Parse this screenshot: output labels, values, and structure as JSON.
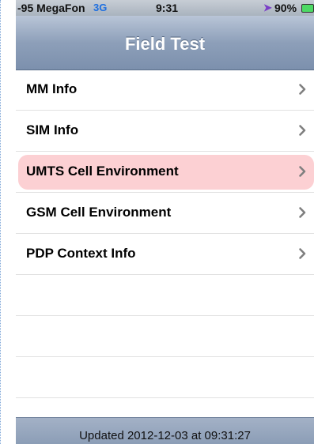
{
  "status_bar": {
    "carrier": "-95 MegaFon",
    "network": "3G",
    "time": "9:31",
    "battery": "90%",
    "icons": [
      "location-arrow-icon",
      "battery-icon"
    ]
  },
  "nav": {
    "title": "Field Test"
  },
  "menu": {
    "items": [
      {
        "label": "MM Info"
      },
      {
        "label": "SIM Info"
      },
      {
        "label": "UMTS Cell Environment",
        "highlighted": true
      },
      {
        "label": "GSM Cell Environment"
      },
      {
        "label": "PDP Context Info"
      }
    ]
  },
  "footer": {
    "updated": "Updated 2012-12-03 at 09:31:27"
  },
  "colors": {
    "highlight": "#fcd0d3",
    "nav_bar": "#8d9fb9",
    "network": "#1e6fe0"
  }
}
